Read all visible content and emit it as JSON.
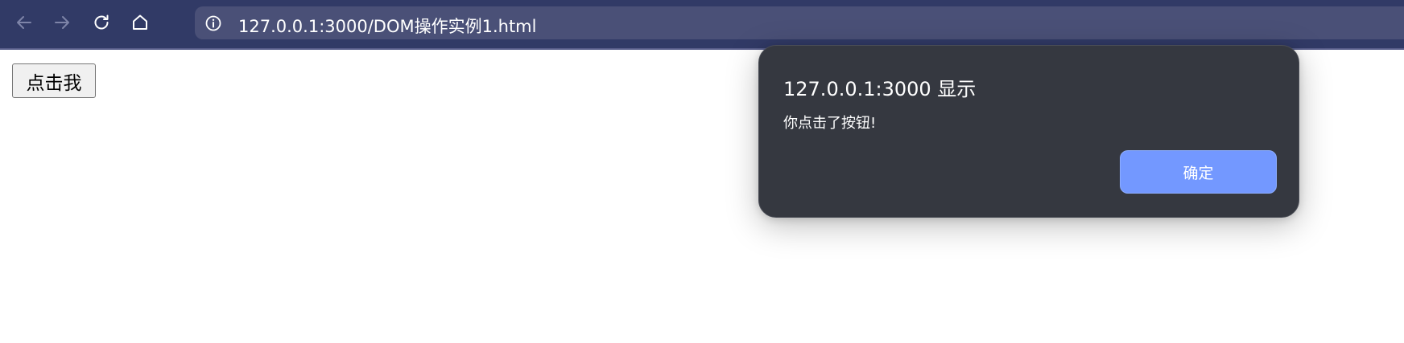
{
  "browser": {
    "url": "127.0.0.1:3000/DOM操作实例1.html",
    "icons": [
      "back-arrow-icon",
      "forward-arrow-icon",
      "reload-icon",
      "home-icon",
      "info-icon"
    ],
    "toolbar_color": "#313a66"
  },
  "page": {
    "button_label": "点击我"
  },
  "alert": {
    "title": "127.0.0.1:3000 显示",
    "message": "你点击了按钮!",
    "ok_label": "确定",
    "ok_color": "#7398ff",
    "background_color": "#353840"
  }
}
